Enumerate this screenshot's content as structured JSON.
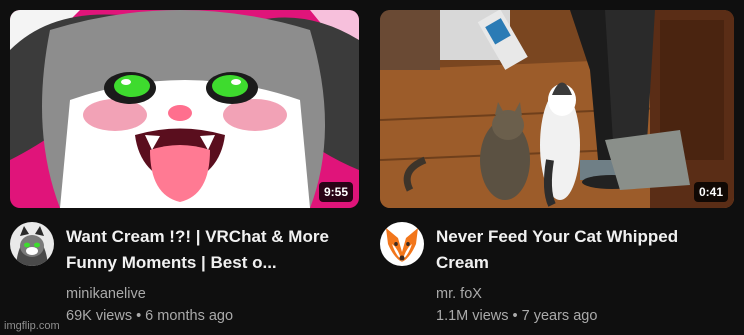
{
  "videos": [
    {
      "duration": "9:55",
      "title": "Want Cream !?! | VRChat & More Funny Moments | Best o...",
      "channel": "minikanelive",
      "views": "69K views",
      "age": "6 months ago",
      "thumbnail_icon": "anime-cat-face-thumbnail",
      "avatar_icon": "cat-avatar-icon"
    },
    {
      "duration": "0:41",
      "title": "Never Feed Your Cat Whipped Cream",
      "channel": "mr. foX",
      "views": "1.1M views",
      "age": "7 years ago",
      "thumbnail_icon": "cats-whipped-cream-thumbnail",
      "avatar_icon": "fox-avatar-icon"
    }
  ],
  "separator": "•",
  "watermark": "imgflip.com",
  "colors": {
    "background": "#0f0f0f",
    "title": "#f1f1f1",
    "secondary": "#aaaaaa",
    "badge": "#000000"
  }
}
